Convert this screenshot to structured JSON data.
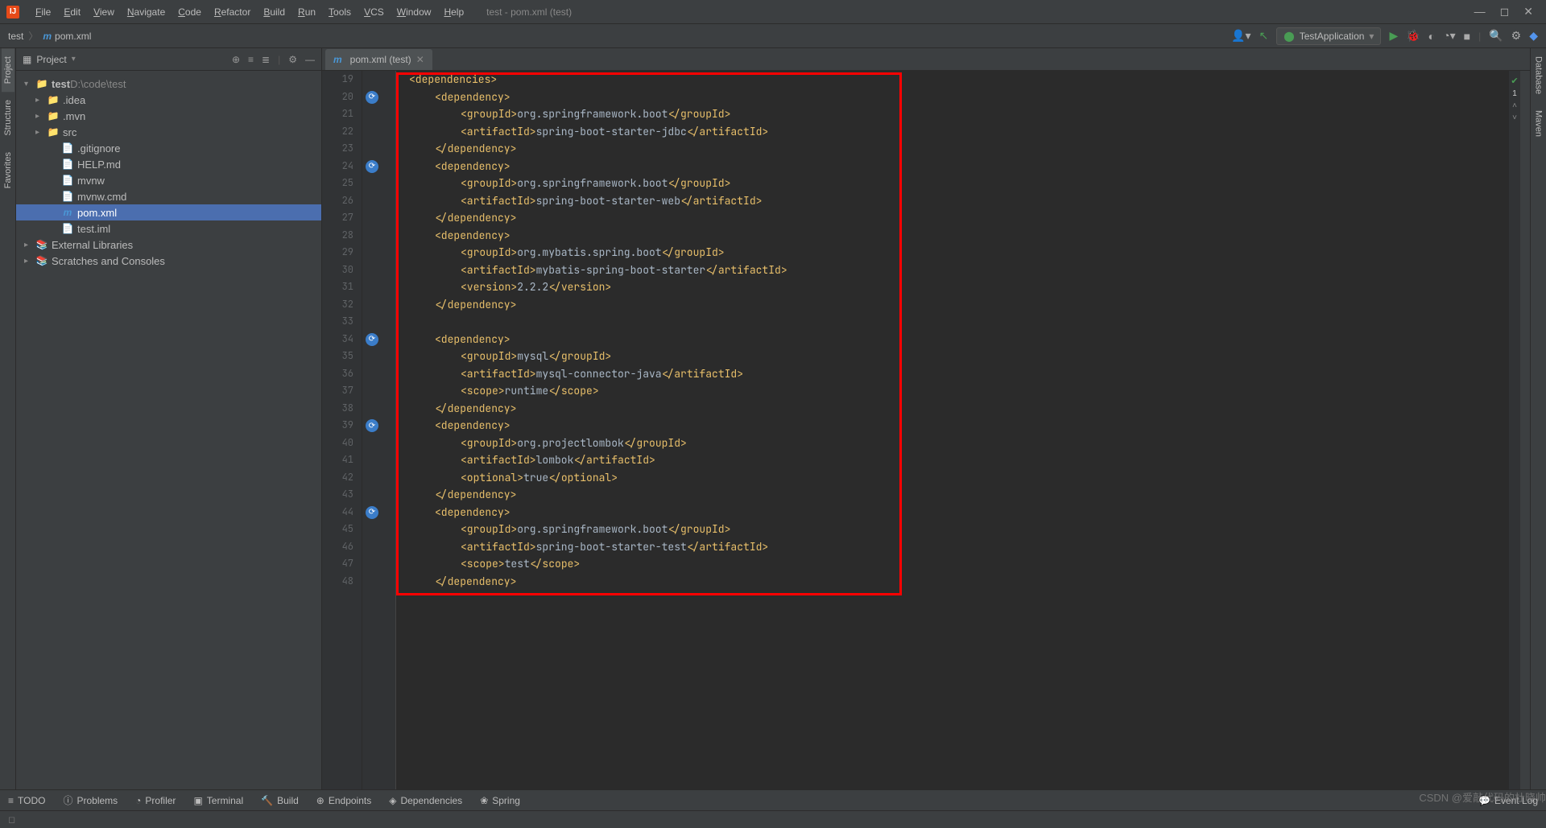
{
  "window": {
    "title": "test - pom.xml (test)"
  },
  "menu": [
    "File",
    "Edit",
    "View",
    "Navigate",
    "Code",
    "Refactor",
    "Build",
    "Run",
    "Tools",
    "VCS",
    "Window",
    "Help"
  ],
  "breadcrumb": {
    "root": "test",
    "file": "pom.xml"
  },
  "run_config": "TestApplication",
  "project_panel": {
    "title": "Project",
    "root": {
      "name": "test",
      "path": "D:\\code\\test"
    },
    "folders": [
      ".idea",
      ".mvn",
      "src"
    ],
    "files": [
      {
        "name": ".gitignore",
        "icon": "git"
      },
      {
        "name": "HELP.md",
        "icon": "md"
      },
      {
        "name": "mvnw",
        "icon": "sh"
      },
      {
        "name": "mvnw.cmd",
        "icon": "cmd"
      },
      {
        "name": "pom.xml",
        "icon": "mvn",
        "selected": true
      },
      {
        "name": "test.iml",
        "icon": "iml"
      }
    ],
    "extra": [
      "External Libraries",
      "Scratches and Consoles"
    ]
  },
  "editor": {
    "tabLabel": "pom.xml (test)",
    "startLine": 19,
    "checkCount": "1",
    "lines": [
      {
        "n": 19,
        "ind": 1,
        "parts": [
          {
            "t": "tag",
            "v": "<dependencies>"
          }
        ]
      },
      {
        "n": 20,
        "ind": 2,
        "parts": [
          {
            "t": "tag",
            "v": "<dependency>"
          }
        ],
        "marker": true
      },
      {
        "n": 21,
        "ind": 3,
        "parts": [
          {
            "t": "tag",
            "v": "<groupId>"
          },
          {
            "t": "val",
            "v": "org.springframework.boot"
          },
          {
            "t": "tag",
            "v": "</groupId>"
          }
        ]
      },
      {
        "n": 22,
        "ind": 3,
        "parts": [
          {
            "t": "tag",
            "v": "<artifactId>"
          },
          {
            "t": "val",
            "v": "spring-boot-starter-jdbc"
          },
          {
            "t": "tag",
            "v": "</artifactId>"
          }
        ]
      },
      {
        "n": 23,
        "ind": 2,
        "parts": [
          {
            "t": "tag",
            "v": "</dependency>"
          }
        ]
      },
      {
        "n": 24,
        "ind": 2,
        "parts": [
          {
            "t": "tag",
            "v": "<dependency>"
          }
        ],
        "marker": true
      },
      {
        "n": 25,
        "ind": 3,
        "parts": [
          {
            "t": "tag",
            "v": "<groupId>"
          },
          {
            "t": "val",
            "v": "org.springframework.boot"
          },
          {
            "t": "tag",
            "v": "</groupId>"
          }
        ]
      },
      {
        "n": 26,
        "ind": 3,
        "parts": [
          {
            "t": "tag",
            "v": "<artifactId>"
          },
          {
            "t": "val",
            "v": "spring-boot-starter-web"
          },
          {
            "t": "tag",
            "v": "</artifactId>"
          }
        ]
      },
      {
        "n": 27,
        "ind": 2,
        "parts": [
          {
            "t": "tag",
            "v": "</dependency>"
          }
        ]
      },
      {
        "n": 28,
        "ind": 2,
        "parts": [
          {
            "t": "tag",
            "v": "<dependency>"
          }
        ]
      },
      {
        "n": 29,
        "ind": 3,
        "parts": [
          {
            "t": "tag",
            "v": "<groupId>"
          },
          {
            "t": "val",
            "v": "org.mybatis.spring.boot"
          },
          {
            "t": "tag",
            "v": "</groupId>"
          }
        ]
      },
      {
        "n": 30,
        "ind": 3,
        "parts": [
          {
            "t": "tag",
            "v": "<artifactId>"
          },
          {
            "t": "val",
            "v": "mybatis-spring-boot-starter"
          },
          {
            "t": "tag",
            "v": "</artifactId>"
          }
        ]
      },
      {
        "n": 31,
        "ind": 3,
        "parts": [
          {
            "t": "tag",
            "v": "<version>"
          },
          {
            "t": "val",
            "v": "2.2.2"
          },
          {
            "t": "tag",
            "v": "</version>"
          }
        ]
      },
      {
        "n": 32,
        "ind": 2,
        "parts": [
          {
            "t": "tag",
            "v": "</dependency>"
          }
        ]
      },
      {
        "n": 33,
        "ind": 0,
        "parts": []
      },
      {
        "n": 34,
        "ind": 2,
        "parts": [
          {
            "t": "tag",
            "v": "<dependency>"
          }
        ],
        "marker": true
      },
      {
        "n": 35,
        "ind": 3,
        "parts": [
          {
            "t": "tag",
            "v": "<groupId>"
          },
          {
            "t": "val",
            "v": "mysql"
          },
          {
            "t": "tag",
            "v": "</groupId>"
          }
        ]
      },
      {
        "n": 36,
        "ind": 3,
        "parts": [
          {
            "t": "tag",
            "v": "<artifactId>"
          },
          {
            "t": "val",
            "v": "mysql-connector-java"
          },
          {
            "t": "tag",
            "v": "</artifactId>"
          }
        ]
      },
      {
        "n": 37,
        "ind": 3,
        "parts": [
          {
            "t": "tag",
            "v": "<scope>"
          },
          {
            "t": "val",
            "v": "runtime"
          },
          {
            "t": "tag",
            "v": "</scope>"
          }
        ]
      },
      {
        "n": 38,
        "ind": 2,
        "parts": [
          {
            "t": "tag",
            "v": "</dependency>"
          }
        ]
      },
      {
        "n": 39,
        "ind": 2,
        "parts": [
          {
            "t": "tag",
            "v": "<dependency>"
          }
        ],
        "marker": true
      },
      {
        "n": 40,
        "ind": 3,
        "parts": [
          {
            "t": "tag",
            "v": "<groupId>"
          },
          {
            "t": "val",
            "v": "org.projectlombok"
          },
          {
            "t": "tag",
            "v": "</groupId>"
          }
        ]
      },
      {
        "n": 41,
        "ind": 3,
        "parts": [
          {
            "t": "tag",
            "v": "<artifactId>"
          },
          {
            "t": "val",
            "v": "lombok"
          },
          {
            "t": "tag",
            "v": "</artifactId>"
          }
        ]
      },
      {
        "n": 42,
        "ind": 3,
        "parts": [
          {
            "t": "tag",
            "v": "<optional>"
          },
          {
            "t": "val",
            "v": "true"
          },
          {
            "t": "tag",
            "v": "</optional>"
          }
        ]
      },
      {
        "n": 43,
        "ind": 2,
        "parts": [
          {
            "t": "tag",
            "v": "</dependency>"
          }
        ]
      },
      {
        "n": 44,
        "ind": 2,
        "parts": [
          {
            "t": "tag",
            "v": "<dependency>"
          }
        ],
        "marker": true
      },
      {
        "n": 45,
        "ind": 3,
        "parts": [
          {
            "t": "tag",
            "v": "<groupId>"
          },
          {
            "t": "val",
            "v": "org.springframework.boot"
          },
          {
            "t": "tag",
            "v": "</groupId>"
          }
        ]
      },
      {
        "n": 46,
        "ind": 3,
        "parts": [
          {
            "t": "tag",
            "v": "<artifactId>"
          },
          {
            "t": "val",
            "v": "spring-boot-starter-test"
          },
          {
            "t": "tag",
            "v": "</artifactId>"
          }
        ]
      },
      {
        "n": 47,
        "ind": 3,
        "parts": [
          {
            "t": "tag",
            "v": "<scope>"
          },
          {
            "t": "val",
            "v": "test"
          },
          {
            "t": "tag",
            "v": "</scope>"
          }
        ]
      },
      {
        "n": 48,
        "ind": 2,
        "parts": [
          {
            "t": "tag",
            "v": "</dependency>"
          }
        ]
      }
    ]
  },
  "left_rail": [
    {
      "label": "Project",
      "active": true
    },
    {
      "label": "Structure"
    },
    {
      "label": "Favorites"
    }
  ],
  "right_rail": [
    "Database",
    "Maven"
  ],
  "statusbar": {
    "items": [
      "TODO",
      "Problems",
      "Profiler",
      "Terminal",
      "Build",
      "Endpoints",
      "Dependencies",
      "Spring"
    ],
    "eventLog": "Event Log"
  },
  "watermark": "CSDN @爱敲代码的杜晓帅"
}
